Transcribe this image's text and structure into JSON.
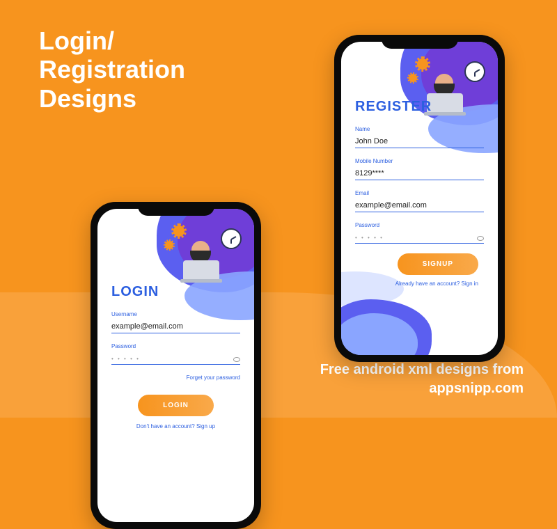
{
  "hero": {
    "title_line1": "Login/",
    "title_line2": "Registration",
    "title_line3": "Designs"
  },
  "footer": {
    "line1": "Free android xml designs from",
    "line2": "appsnipp.com"
  },
  "login": {
    "title": "LOGIN",
    "username_label": "Username",
    "username_value": "example@email.com",
    "password_label": "Password",
    "password_value": "• • • • •",
    "forgot_link": "Forget your password",
    "button": "LOGIN",
    "alt_link": "Don't have an account? Sign up"
  },
  "register": {
    "title": "REGISTER",
    "name_label": "Name",
    "name_value": "John Doe",
    "mobile_label": "Mobile Number",
    "mobile_value": "8129****",
    "email_label": "Email",
    "email_value": "example@email.com",
    "password_label": "Password",
    "password_value": "• • • • •",
    "button": "SIGNUP",
    "alt_link": "Already have an account? Sign in"
  }
}
